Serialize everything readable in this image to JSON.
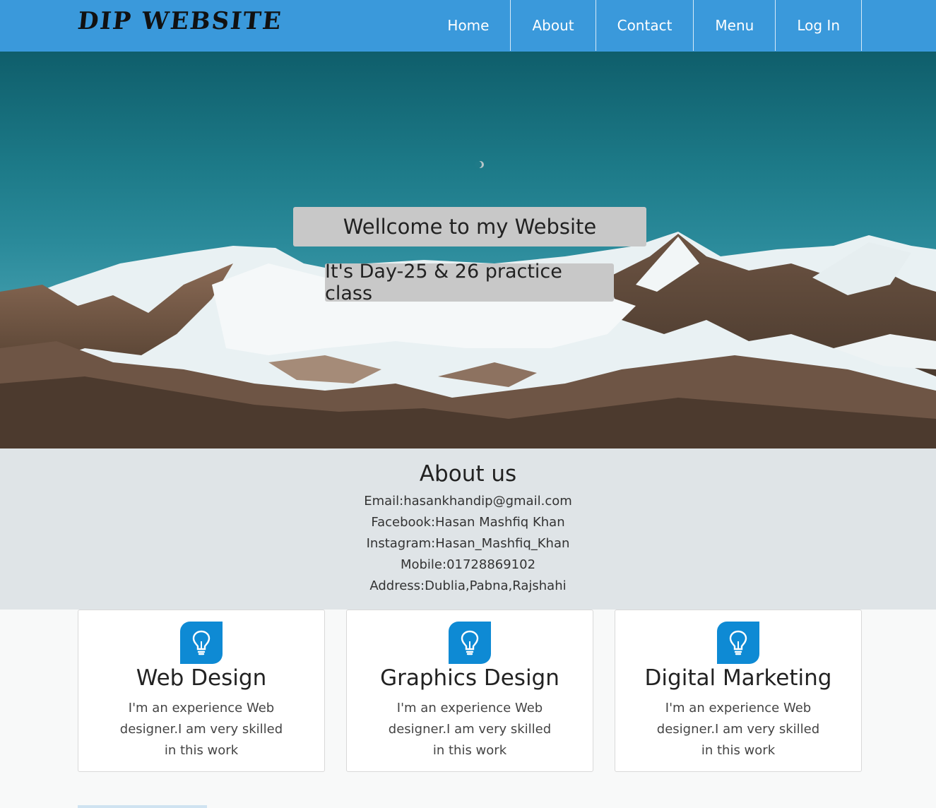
{
  "brand": "DIP WEBSITE",
  "nav": {
    "items": [
      {
        "label": "Home"
      },
      {
        "label": "About"
      },
      {
        "label": "Contact"
      },
      {
        "label": "Menu"
      },
      {
        "label": "Log In"
      }
    ]
  },
  "hero": {
    "title": "Wellcome to my Website",
    "subtitle": "It's Day-25 & 26 practice class"
  },
  "about": {
    "heading": "About us",
    "lines": [
      "Email:hasankhandip@gmail.com",
      "Facebook:Hasan Mashfiq Khan",
      "Instagram:Hasan_Mashfiq_Khan",
      "Mobile:01728869102",
      "Address:Dublia,Pabna,Rajshahi"
    ]
  },
  "services": [
    {
      "title": "Web Design",
      "text": "I'm an experience Web designer.I am very skilled in this work",
      "icon": "lightbulb-icon"
    },
    {
      "title": "Graphics Design",
      "text": "I'm an experience Web designer.I am very skilled in this work",
      "icon": "lightbulb-icon"
    },
    {
      "title": "Digital Marketing",
      "text": "I'm an experience Web designer.I am very skilled in this work",
      "icon": "lightbulb-icon"
    }
  ],
  "colors": {
    "navbar": "#3a99db",
    "icon_bg": "#0e8ad4",
    "about_bg": "#dfe4e7"
  }
}
